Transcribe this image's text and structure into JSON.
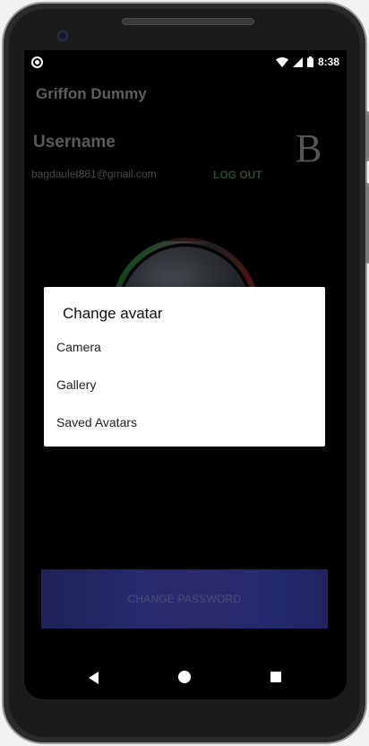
{
  "status_bar": {
    "time": "8:38"
  },
  "app_bar": {
    "title": "Griffon Dummy"
  },
  "profile": {
    "username": "Username",
    "email": "bagdaulet881@gmail.com",
    "logout_label": "LOG OUT",
    "initial_letter": "B"
  },
  "change_password_label": "CHANGE PASSWORD",
  "dialog": {
    "title": "Change avatar",
    "items": [
      {
        "label": "Camera"
      },
      {
        "label": "Gallery"
      },
      {
        "label": "Saved Avatars"
      }
    ]
  },
  "colors": {
    "accent_green": "#264b30",
    "button_indigo": "#262b6e"
  }
}
